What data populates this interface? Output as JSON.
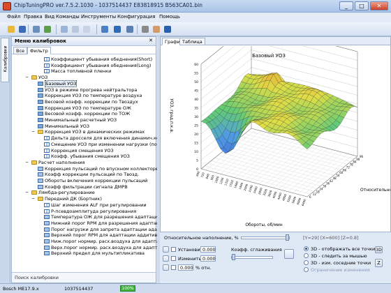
{
  "window": {
    "title": "ChipTuningPRO ver.7.5.2.1030 - 1037514437 E83818915 B563CA01.bin",
    "minimize": "_",
    "maximize": "□",
    "close": "✕"
  },
  "menu": [
    "Файл",
    "Правка",
    "Вид",
    "Команды",
    "Инструменты",
    "Конфигурация",
    "Помощь"
  ],
  "toolbar": {
    "icons": [
      {
        "name": "open-folder-icon",
        "color": "#e8b83a"
      },
      {
        "name": "save-icon",
        "color": "#3a6ab8"
      },
      {
        "name": "print-icon",
        "color": "#6b8fbf"
      },
      {
        "name": "checksum-icon",
        "color": "#5e9e4c"
      },
      {
        "name": "copy-icon",
        "color": "#9ab4d8"
      },
      {
        "name": "paste-icon",
        "color": "#b8c8de"
      },
      {
        "name": "undo-icon",
        "color": "#c8d4e4"
      },
      {
        "name": "compare-icon",
        "color": "#4a7fc4"
      },
      {
        "name": "navigate-icon",
        "color": "#2d6ab8"
      },
      {
        "name": "search-icon",
        "color": "#5a7fb0"
      },
      {
        "name": "tools-icon",
        "color": "#8a8a8a"
      },
      {
        "name": "hand-icon",
        "color": "#d49a6a"
      },
      {
        "name": "help-icon",
        "color": "#2a5fb0"
      }
    ]
  },
  "left_panel": {
    "vertical_tab": "Калибровки",
    "header": "Меню калибровок",
    "close": "✕",
    "tabs": [
      "Все",
      "Фильтр"
    ],
    "tree": [
      {
        "indent": 2,
        "icon": "line",
        "label": "Коэффициент убывания обеднения(Short)"
      },
      {
        "indent": 2,
        "icon": "line",
        "label": "Коэффициент убывания обеднения(Long)"
      },
      {
        "indent": 2,
        "icon": "line",
        "label": "Масса топливной пленки"
      },
      {
        "indent": 0,
        "icon": "folder",
        "label": "УОЗ",
        "expander": "−"
      },
      {
        "indent": 1,
        "icon": "grid",
        "label": "Базовый УОЗ",
        "selected": true
      },
      {
        "indent": 1,
        "icon": "grid",
        "label": "УОЗ в режиме прогрева нейтральтора"
      },
      {
        "indent": 1,
        "icon": "grid",
        "label": "Коррекция УОЗ по температуре воздуха"
      },
      {
        "indent": 1,
        "icon": "grid",
        "label": "Весовой коэфф. коррекции по Твоздух"
      },
      {
        "indent": 1,
        "icon": "grid",
        "label": "Коррекция УОЗ по температуре ОЖ"
      },
      {
        "indent": 1,
        "icon": "grid",
        "label": "Весовой коэфф. коррекции по ТОЖ"
      },
      {
        "indent": 1,
        "icon": "grid",
        "label": "Минимальный расчетный УОЗ"
      },
      {
        "indent": 1,
        "icon": "grid",
        "label": "Минимальный УОЗ"
      },
      {
        "indent": 1,
        "icon": "folder",
        "label": "Коррекция УОЗ в динамических режимах",
        "expander": "−"
      },
      {
        "indent": 2,
        "icon": "line",
        "label": "Дельта дросселя для включения динамич.кор..."
      },
      {
        "indent": 2,
        "icon": "line",
        "label": "Смещение УОЗ при изменении нагрузки (по..."
      },
      {
        "indent": 2,
        "icon": "line",
        "label": "Коррекция смещения УОЗ"
      },
      {
        "indent": 2,
        "icon": "line",
        "label": "Коэфф. убывания смещения УОЗ"
      },
      {
        "indent": 0,
        "icon": "folder",
        "label": "Расчет наполнения",
        "expander": "−"
      },
      {
        "indent": 1,
        "icon": "chart",
        "label": "Коррекция пульсаций по впускном коллекторе"
      },
      {
        "indent": 1,
        "icon": "chart",
        "label": "Коэфф коррекции пульсаций по Твозд."
      },
      {
        "indent": 1,
        "icon": "chart",
        "label": "Обороты включения коррекции пульсаций"
      },
      {
        "indent": 1,
        "icon": "chart",
        "label": "Коэфф фильтрации сигнала ДМРВ"
      },
      {
        "indent": 0,
        "icon": "folder",
        "label": "Лямбда-регулирование",
        "expander": "−"
      },
      {
        "indent": 1,
        "icon": "folder",
        "label": "Передний ДК (Бортник)",
        "expander": "−"
      },
      {
        "indent": 2,
        "icon": "line",
        "label": "Шаг изменения ALF при регулировании"
      },
      {
        "indent": 2,
        "icon": "line",
        "label": "Р-псевдоамплитуда регулирования"
      },
      {
        "indent": 2,
        "icon": "chart",
        "label": "Температура ОЖ для разрешения адаптации ад..."
      },
      {
        "indent": 2,
        "icon": "chart",
        "label": "Нижний порог RPM для разрешения адаптации"
      },
      {
        "indent": 2,
        "icon": "chart",
        "label": "Порог нагрузки для запрета адаптации адаптив..."
      },
      {
        "indent": 2,
        "icon": "chart",
        "label": "Верхний порог RPM для адаптации аддитив"
      },
      {
        "indent": 2,
        "icon": "chart",
        "label": "Ниж.порог нормир. расх.воздуха для адаптации адд..."
      },
      {
        "indent": 2,
        "icon": "chart",
        "label": "Верх.порог нормир. расх.воздуха для адаптации адд..."
      },
      {
        "indent": 2,
        "icon": "chart",
        "label": "Верхний предел для мультипликатива"
      }
    ],
    "search_label": "Поиск калибровки"
  },
  "right_panel": {
    "tabs": [
      "График",
      "Таблица"
    ]
  },
  "chart_data": {
    "type": "surface3d",
    "title": "Базовый УОЗ",
    "xlabel": "Обороты, об/мин",
    "ylabel": "Относительное",
    "zlabel": "УОЗ, град.п.к.в.",
    "x_ticks": [
      "600",
      "720",
      "840",
      "960",
      "1080",
      "1200",
      "1320",
      "1520",
      "1680",
      "1840",
      "2000",
      "2200",
      "2400",
      "2800",
      "3200",
      "3600",
      "4000",
      "4400",
      "4800",
      "5200",
      "5600",
      "6000",
      "6400"
    ],
    "y_ticks": [
      "6",
      "12",
      "18",
      "24",
      "30",
      "36",
      "42",
      "48",
      "54",
      "60",
      "66",
      "72",
      "78",
      "84",
      "90",
      "96"
    ],
    "z_ticks": [
      "0",
      "5",
      "10",
      "15",
      "20",
      "25",
      "30",
      "35",
      "40",
      "45",
      "50",
      "55",
      "60"
    ],
    "zlim": [
      0,
      60
    ],
    "grid": true,
    "colormap": "blue-green-yellow-red"
  },
  "controls": {
    "relative_fill_label": "Относительное наполнение, %",
    "relative_fill_value": "",
    "status_text": "[Y=29] [X=600] [Z=0.8]",
    "set_to_label": "Установить в",
    "set_to_value": "0.000",
    "change_by_label": "Изменить на",
    "change_by_value": "0.000",
    "percent_value": "0.000",
    "percent_label": "% отн.",
    "smoothing_label": "Коэфф. сглаживания",
    "options": [
      {
        "label": "3D - отображать все точки",
        "selected": true
      },
      {
        "label": "3D - следить за мышью",
        "selected": false
      },
      {
        "label": "3D - изм. соседние точки",
        "selected": false
      },
      {
        "label": "Ограничение изменения",
        "selected": false
      }
    ],
    "btn_3d": "3D"
  },
  "statusbar": {
    "ecu": "Bosch ME17.9.x",
    "id": "1037514437",
    "progress": "100%",
    "progress_fraction": 1.0
  }
}
